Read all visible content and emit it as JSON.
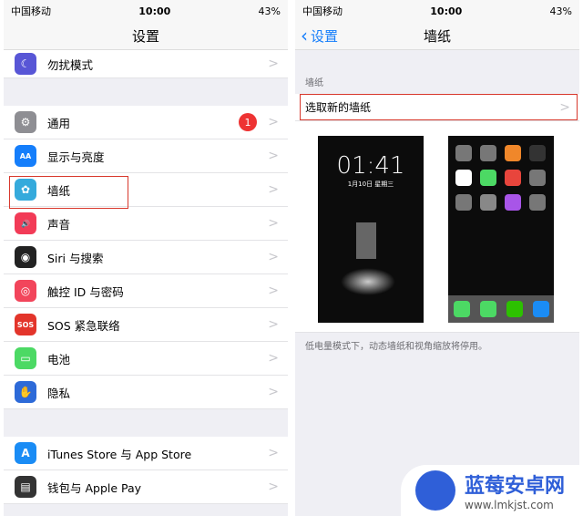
{
  "status": {
    "carrier": "中国移动",
    "time": "10:00",
    "battery": "43%"
  },
  "left": {
    "title": "设置",
    "top_item": "勿扰模式",
    "group1": [
      {
        "label": "通用",
        "icon": "gear-icon",
        "color": "#8e8e93",
        "glyph": "⚙",
        "badge": "1"
      },
      {
        "label": "显示与亮度",
        "icon": "text-size-icon",
        "color": "#157efb",
        "glyph": "AA"
      },
      {
        "label": "墙纸",
        "icon": "wallpaper-flower-icon",
        "color": "#35aadc",
        "glyph": "✿"
      },
      {
        "label": "声音",
        "icon": "speaker-icon",
        "color": "#f23b57",
        "glyph": "🔊"
      },
      {
        "label": "Siri 与搜索",
        "icon": "siri-icon",
        "color": "#222",
        "glyph": "◉"
      },
      {
        "label": "触控 ID 与密码",
        "icon": "fingerprint-icon",
        "color": "#f2455b",
        "glyph": "◎"
      },
      {
        "label": "SOS 紧急联络",
        "icon": "sos-icon",
        "color": "#e3352b",
        "glyph": "SOS"
      },
      {
        "label": "电池",
        "icon": "battery-icon",
        "color": "#4cd964",
        "glyph": "▭"
      },
      {
        "label": "隐私",
        "icon": "hand-icon",
        "color": "#2d6ad8",
        "glyph": "✋"
      }
    ],
    "group2": [
      {
        "label": "iTunes Store 与 App Store",
        "icon": "app-store-icon",
        "color": "#1a8cf5",
        "glyph": "A"
      },
      {
        "label": "钱包与 Apple Pay",
        "icon": "wallet-icon",
        "color": "#333",
        "glyph": "▤"
      }
    ]
  },
  "right": {
    "back": "设置",
    "title": "墙纸",
    "section": "墙纸",
    "pick": "选取新的墙纸",
    "lock_time": "01:41",
    "lock_date": "1月10日 星期三",
    "footnote": "低电量模式下，动态墙纸和视角缩放将停用。"
  },
  "watermark": {
    "name": "蓝莓安卓网",
    "url": "www.lmkjst.com"
  }
}
